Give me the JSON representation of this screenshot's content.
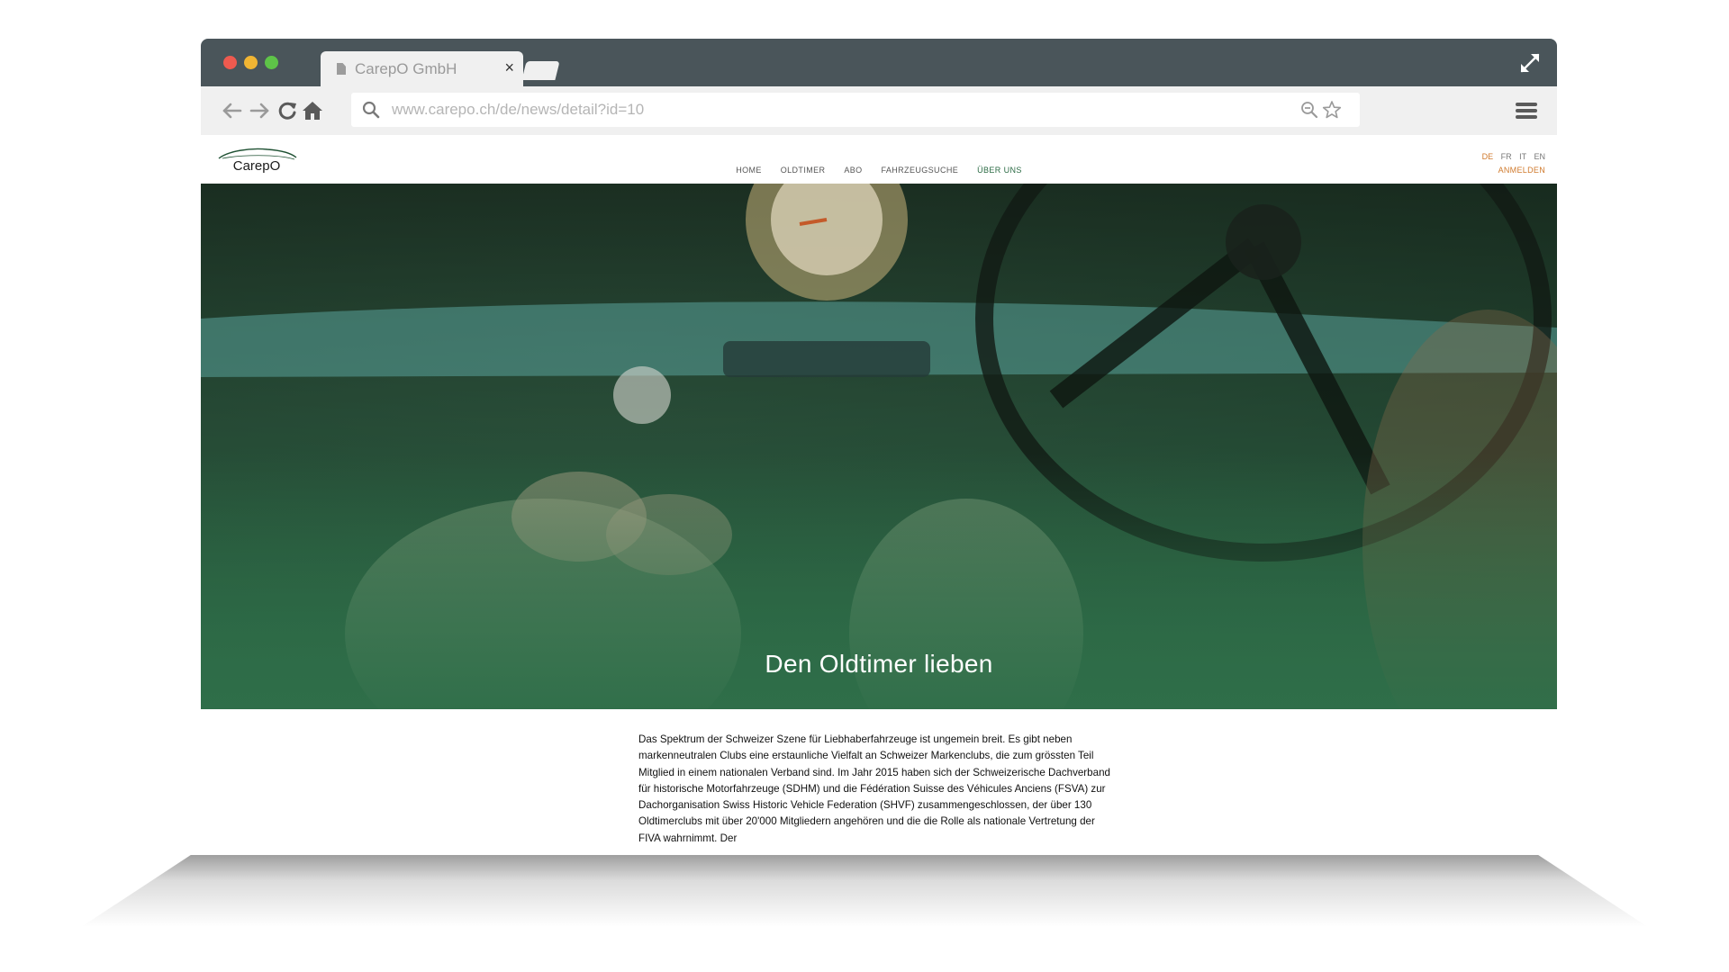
{
  "browser": {
    "tab_title": "CarepO GmbH",
    "tab_close": "×",
    "url": "www.carepo.ch/de/news/detail?id=10",
    "icons": [
      "back-arrow-icon",
      "forward-arrow-icon",
      "reload-icon",
      "home-icon",
      "search-icon",
      "zoom-icon",
      "star-icon",
      "hamburger-menu-icon",
      "expand-icon",
      "document-icon"
    ]
  },
  "site": {
    "logo_text": "CarepO",
    "nav": [
      "HOME",
      "OLDTIMER",
      "ABO",
      "FAHRZEUGSUCHE",
      "ÜBER UNS"
    ],
    "languages": [
      "DE",
      "FR",
      "IT",
      "EN"
    ],
    "login": "ANMELDEN",
    "hero_title": "Den Oldtimer lieben",
    "article_text": "Das Spektrum der Schweizer Szene für Liebhaberfahrzeuge ist ungemein breit. Es gibt neben markenneutralen Clubs eine erstaunliche Vielfalt an Schweizer Markenclubs, die zum grössten Teil Mitglied in einem nationalen Verband sind. Im Jahr 2015 haben sich der Schweizerische Dachverband für historische Motorfahrzeuge (SDHM) und die Fédération Suisse des Véhicules Anciens (FSVA) zur Dachorganisation Swiss Historic Vehicle Federation (SHVF) zusammengeschlossen, der über 130 Oldtimerclubs mit über 20'000 Mitgliedern angehören und die die Rolle als nationale Vertretung der FIVA wahrnimmt. Der"
  },
  "colors": {
    "accent_green": "#2a6a43",
    "accent_orange": "#d07a2d",
    "chrome_dark": "#4a555a"
  }
}
